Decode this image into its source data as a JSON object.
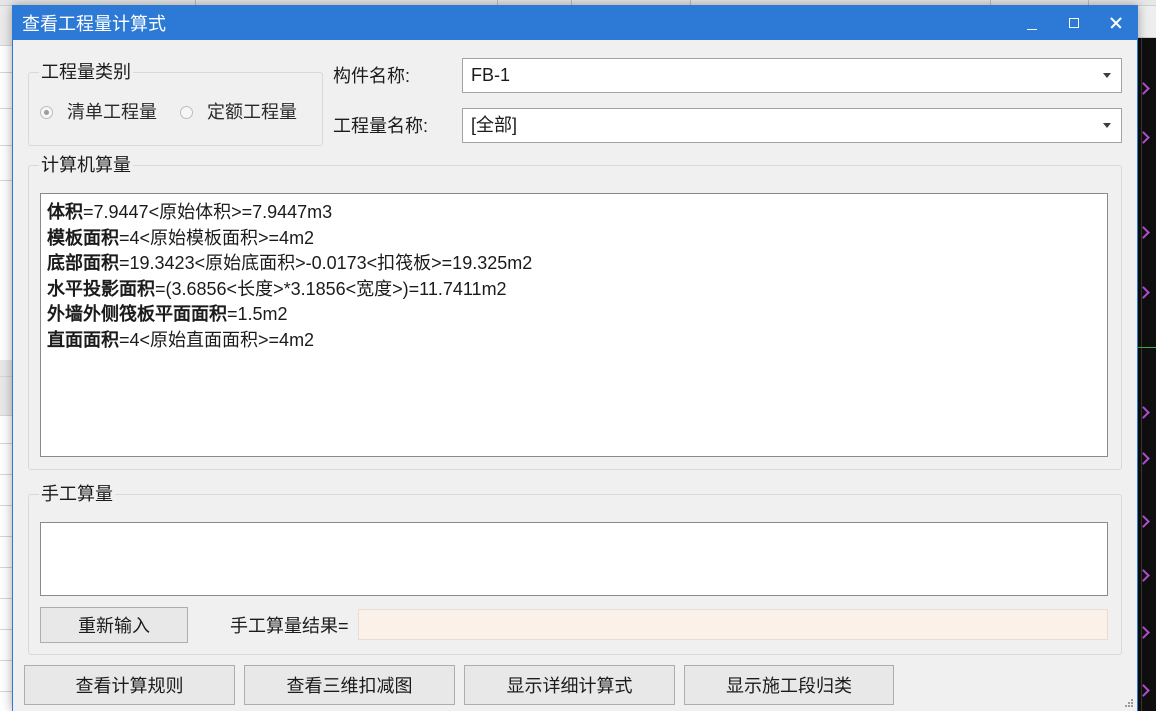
{
  "colors": {
    "accent": "#2c7ad6",
    "result_field_bg": "#fcf1e9"
  },
  "icons": {
    "minimize": "minimize-icon",
    "maximize": "maximize-icon",
    "close": "close-icon",
    "dropdown": "chevron-down-icon",
    "resize": "resize-grip-icon"
  },
  "dialog": {
    "title": "查看工程量计算式"
  },
  "quantity_type": {
    "legend": "工程量类别",
    "options": [
      {
        "label": "清单工程量",
        "checked": true
      },
      {
        "label": "定额工程量",
        "checked": false
      }
    ]
  },
  "component": {
    "label": "构件名称:",
    "value": "FB-1"
  },
  "quantity_name": {
    "label": "工程量名称:",
    "value": "[全部]"
  },
  "computed": {
    "legend": "计算机算量",
    "lines": [
      {
        "name": "体积",
        "expr": "=7.9447<原始体积>=7.9447m3"
      },
      {
        "name": "模板面积",
        "expr": "=4<原始模板面积>=4m2"
      },
      {
        "name": "底部面积",
        "expr": "=19.3423<原始底面积>-0.0173<扣筏板>=19.325m2"
      },
      {
        "name": "水平投影面积",
        "expr": "=(3.6856<长度>*3.1856<宽度>)=11.7411m2"
      },
      {
        "name": "外墙外侧筏板平面面积",
        "expr": "=1.5m2"
      },
      {
        "name": "直面面积",
        "expr": "=4<原始直面面积>=4m2"
      }
    ]
  },
  "manual": {
    "legend": "手工算量",
    "formula": "",
    "reenter_label": "重新输入",
    "result_label": "手工算量结果=",
    "result_value": ""
  },
  "footer": {
    "buttons": [
      {
        "label": "查看计算规则"
      },
      {
        "label": "查看三维扣减图"
      },
      {
        "label": "显示详细计算式"
      },
      {
        "label": "显示施工段归类"
      }
    ]
  }
}
